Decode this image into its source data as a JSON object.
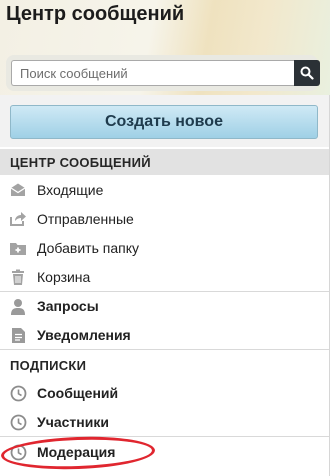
{
  "header": {
    "title": "Центр сообщений"
  },
  "search": {
    "placeholder": "Поиск сообщений"
  },
  "create_button": {
    "label": "Создать новое"
  },
  "sections": {
    "messages": {
      "heading": "ЦЕНТР СООБЩЕНИЙ",
      "items": [
        {
          "label": "Входящие",
          "icon": "inbox-icon"
        },
        {
          "label": "Отправленные",
          "icon": "sent-icon"
        },
        {
          "label": "Добавить папку",
          "icon": "add-folder-icon"
        },
        {
          "label": "Корзина",
          "icon": "trash-icon"
        }
      ]
    },
    "requests": {
      "label": "Запросы",
      "icon": "user-icon"
    },
    "notifications": {
      "label": "Уведомления",
      "icon": "document-icon"
    },
    "subscriptions": {
      "heading": "ПОДПИСКИ",
      "items": [
        {
          "label": "Сообщений",
          "icon": "clock-icon"
        },
        {
          "label": "Участники",
          "icon": "clock-icon"
        },
        {
          "label": "Модерация",
          "icon": "clock-icon"
        }
      ]
    }
  },
  "colors": {
    "accent_button": "#9fd0e6",
    "search_button": "#2b3136",
    "highlight_circle": "#e0262f",
    "icon_grey": "#8c8c8c"
  }
}
